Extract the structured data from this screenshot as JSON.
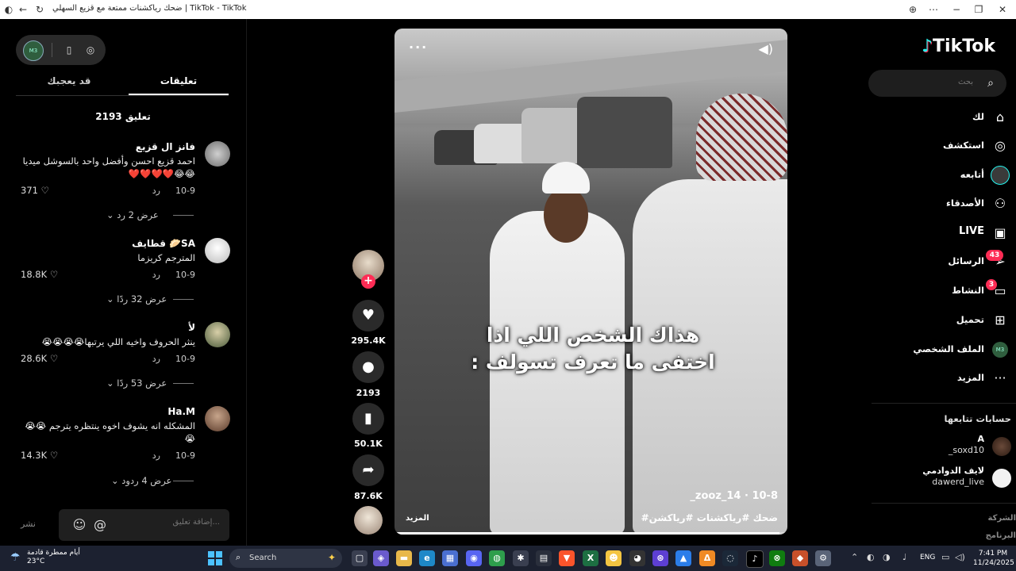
{
  "window": {
    "title": "ضحك رياكشنات ممتعة مع قزيع السهلي | TikTok - TikTok"
  },
  "left_panel": {
    "tabs": [
      "تعليقات",
      "قد يعجبك"
    ],
    "comment_count": "2193 تعليق",
    "comments": [
      {
        "name": "فانز ال قزيع",
        "text": "احمد قزيع احسن وأفضل واحد بالسوشل ميديا 😂😂❤️❤️❤️❤️",
        "date": "10-9",
        "reply": "رد",
        "likes": "371",
        "more": "عرض 2 رد"
      },
      {
        "name": "قطايف 🥟SA",
        "text": "المترجم كريزما",
        "date": "10-9",
        "reply": "رد",
        "likes": "18.8K",
        "more": "عرض 32 ردًا"
      },
      {
        "name": "لأ",
        "text": "ينثر الحروف واخيه اللي يرتبها😭😭😭😭",
        "date": "10-9",
        "reply": "رد",
        "likes": "28.6K",
        "more": "عرض 53 ردًا"
      },
      {
        "name": "Ha.M",
        "text": "المشكله انه يشوف اخوه ينتظره يترجم 😭😭😭",
        "date": "10-9",
        "reply": "رد",
        "likes": "14.3K",
        "more": "عرض 4 ردود"
      }
    ],
    "input_placeholder": "إضافة تعليق...",
    "post_label": "نشر"
  },
  "video": {
    "caption_line1": "هذاك الشخص اللي اذا",
    "caption_line2": "اختفى ما تعرف تسولف :",
    "author": "_zooz_14 · 10-8",
    "hashtags": "#ضحك #رياكشنات #رياكشن",
    "more_label": "المزيد",
    "progress": 0.98
  },
  "actions": {
    "likes": "295.4K",
    "comments": "2193",
    "saves": "50.1K",
    "shares": "87.6K"
  },
  "sidebar": {
    "logo": "TikTok",
    "search_placeholder": "بحث",
    "nav": [
      {
        "label": "لك"
      },
      {
        "label": "استكشف"
      },
      {
        "label": "أتابعه"
      },
      {
        "label": "الأصدقاء"
      },
      {
        "label": "LIVE"
      },
      {
        "label": "الرسائل",
        "badge": "43"
      },
      {
        "label": "النشاط",
        "badge": "3"
      },
      {
        "label": "تحميل"
      },
      {
        "label": "الملف الشخصي"
      },
      {
        "label": "المزيد"
      }
    ],
    "following_title": "حسابات تتابعها",
    "following": [
      {
        "name": "A",
        "handle": "_soxd10"
      },
      {
        "name": "لايف الدوادمي",
        "handle": "dawerd_live"
      }
    ],
    "footer_links": [
      "الشركة",
      "البرنامج"
    ]
  },
  "taskbar": {
    "weather_line1": "أيام ممطرة قادمة",
    "weather_line2": "23°C",
    "search_label": "Search",
    "lang": "ENG",
    "time": "7:41 PM",
    "date": "11/24/2025"
  },
  "colors": {
    "accent": "#fe2c55",
    "cyan": "#25f4ee",
    "taskbar": "#1c2130"
  }
}
